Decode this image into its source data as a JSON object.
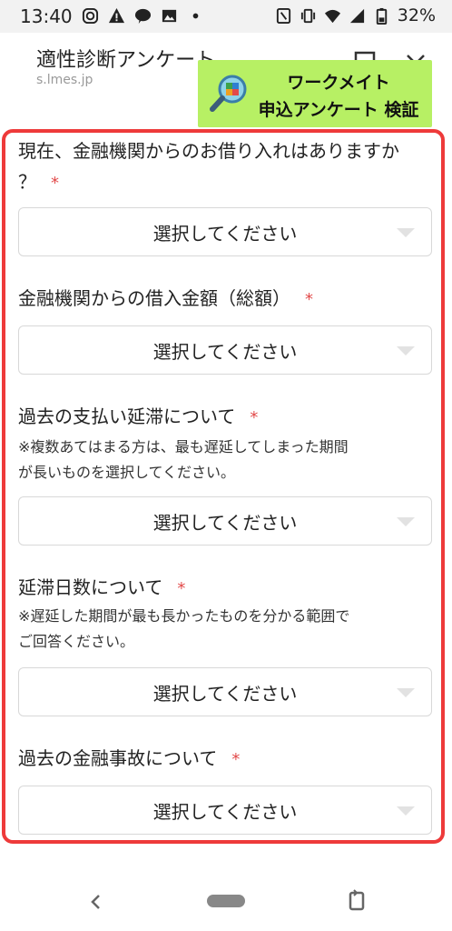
{
  "status": {
    "time": "13:40",
    "battery": "32%"
  },
  "header": {
    "title": "適性診断アンケート",
    "domain": "s.lmes.jp"
  },
  "banner": {
    "line1": "ワークメイト",
    "line2": "申込アンケート 検証"
  },
  "form": {
    "questions": [
      {
        "label": "現在、金融機関からのお借り入れはありますか？",
        "line1": "現在、金融機関からのお借り入れはありますか",
        "line2": "？",
        "required": "*",
        "placeholder": "選択してください"
      },
      {
        "label": "金融機関からの借入金額（総額）",
        "required": "*",
        "placeholder": "選択してください"
      },
      {
        "label": "過去の支払い延滞について",
        "required": "*",
        "note1": "※複数あてはまる方は、最も遅延してしまった期間",
        "note2": "が長いものを選択してください。",
        "placeholder": "選択してください"
      },
      {
        "label": "延滞日数について",
        "required": "*",
        "note1": "※遅延した期間が最も長かったものを分かる範囲で",
        "note2": "ご回答ください。",
        "placeholder": "選択してください"
      },
      {
        "label": "過去の金融事故について",
        "required": "*",
        "placeholder": "選択してください"
      }
    ]
  }
}
